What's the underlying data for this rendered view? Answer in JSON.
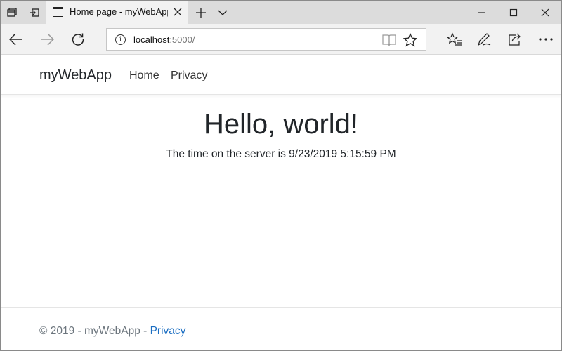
{
  "browser": {
    "tab": {
      "title": "Home page - myWebApp",
      "close_icon": "close-icon"
    },
    "new_tab_icon": "plus-icon",
    "address": {
      "host": "localhost",
      "port_path": ":5000/"
    }
  },
  "site": {
    "brand": "myWebApp",
    "nav": {
      "home": "Home",
      "privacy": "Privacy"
    },
    "heading": "Hello, world!",
    "server_time": "The time on the server is 9/23/2019 5:15:59 PM",
    "footer": {
      "text": "© 2019 - myWebApp - ",
      "privacy_link": "Privacy"
    },
    "colors": {
      "link": "#1b6ec2",
      "muted": "#6c757d"
    }
  }
}
